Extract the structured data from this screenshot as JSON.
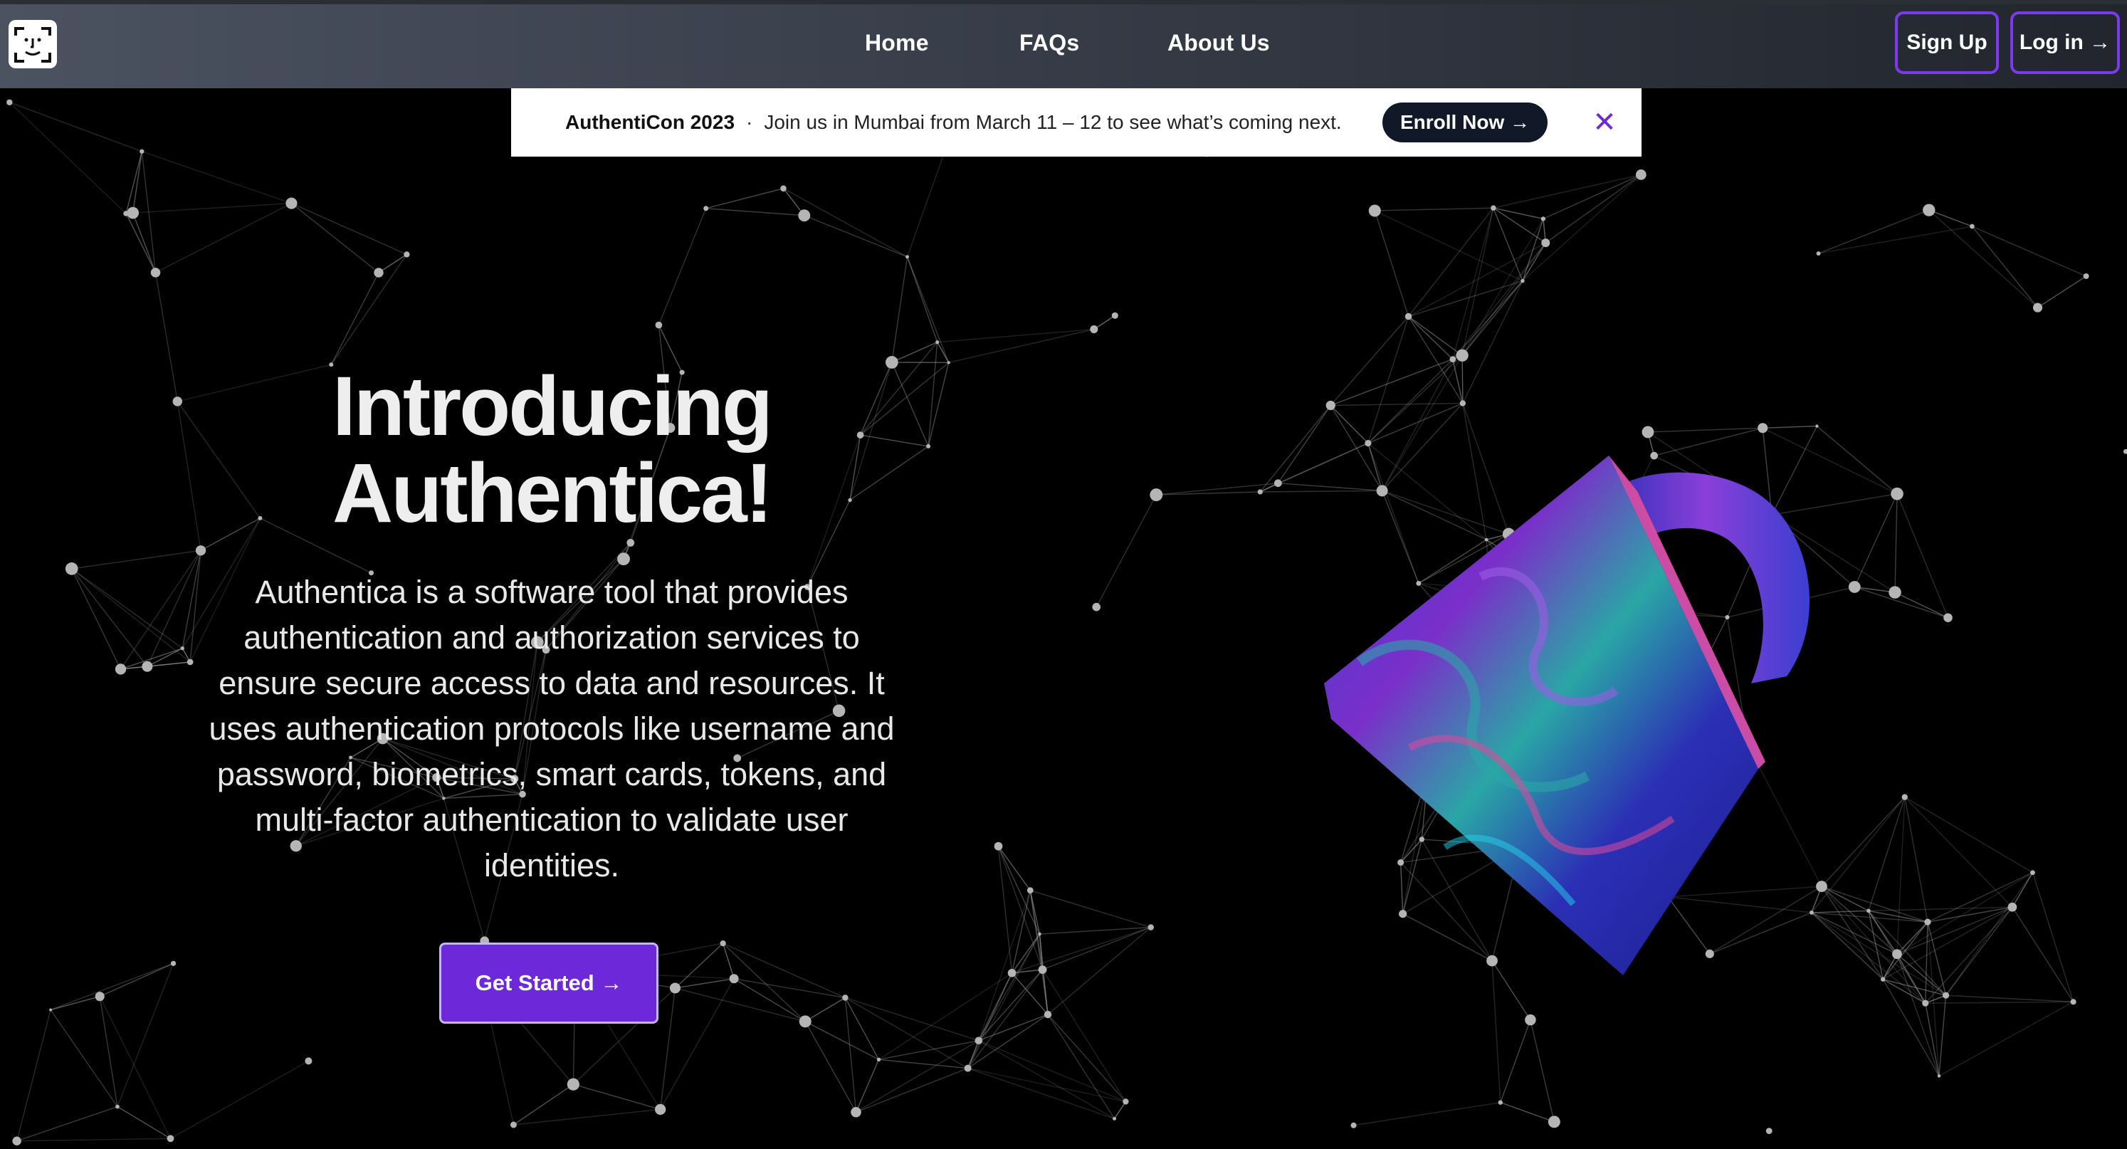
{
  "nav": {
    "links": [
      "Home",
      "FAQs",
      "About Us"
    ],
    "signup": "Sign Up",
    "login": "Log in →",
    "logo_icon": "face-id-icon"
  },
  "banner": {
    "title": "AuthentiCon 2023",
    "separator": "·",
    "message": "Join us in Mumbai from March 11 – 12 to see what’s coming next.",
    "cta": "Enroll Now →",
    "close": "✕"
  },
  "hero": {
    "title_line1": "Introducing",
    "title_line2": "Authentica!",
    "description": "Authentica is a software tool that provides authentication and authorization services to ensure secure access to data and resources. It uses authentication protocols like username and password, biometrics, smart cards, tokens, and multi-factor authentication to validate user identities.",
    "cta": "Get Started →"
  },
  "graphics": {
    "lock_icon": "marbled-padlock-illustration",
    "background": "network-mesh",
    "colors": {
      "accent": "#6d28d9",
      "accent_border": "#7c3aed",
      "background": "#000000",
      "lock_blue": "#2b2fb5",
      "lock_purple": "#7a2fc9",
      "lock_teal": "#2aa6a6",
      "lock_pink": "#e0499a"
    }
  }
}
